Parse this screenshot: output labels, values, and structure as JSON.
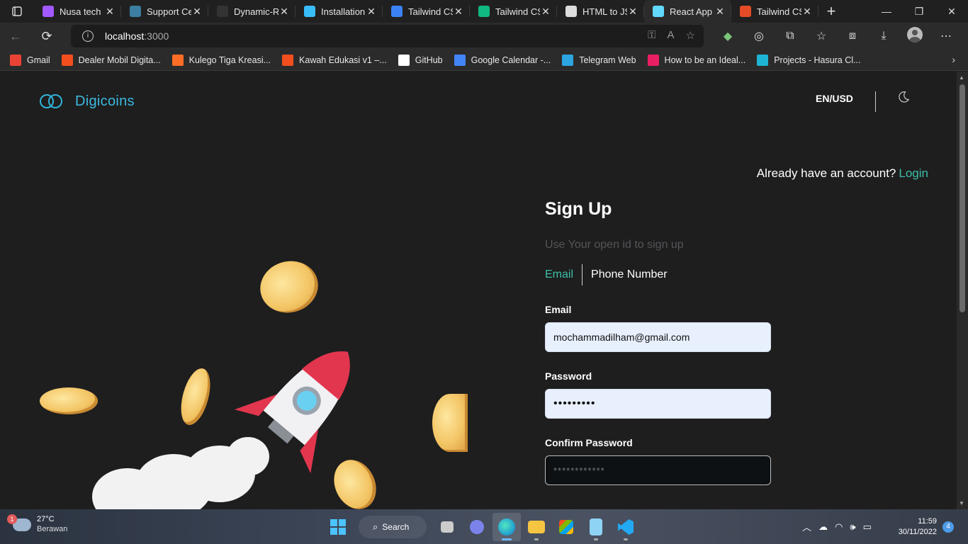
{
  "browser": {
    "tabs": [
      {
        "title": "Nusa tech",
        "icon": "figma-icon",
        "color": "#a259ff"
      },
      {
        "title": "Support Center",
        "icon": "support-icon",
        "color": "#3b7ea1"
      },
      {
        "title": "Dynamic-React",
        "icon": "github-icon",
        "color": "#333333"
      },
      {
        "title": "Installation",
        "icon": "tailwind-icon",
        "color": "#38bdf8"
      },
      {
        "title": "Tailwind CSS",
        "icon": "tailwind-elements-icon",
        "color": "#3b82f6"
      },
      {
        "title": "Tailwind CSS",
        "icon": "leaf-icon",
        "color": "#10b981"
      },
      {
        "title": "HTML to JSX",
        "icon": "document-icon",
        "color": "#dddddd"
      },
      {
        "title": "React App",
        "icon": "react-icon",
        "color": "#61dafb"
      },
      {
        "title": "Tailwind CSS",
        "icon": "code-icon",
        "color": "#e34c26"
      }
    ],
    "active_tab_index": 7,
    "url_host": "localhost",
    "url_port": ":3000",
    "bookmarks": [
      {
        "label": "Gmail",
        "icon": "gmail-icon",
        "color": "#ea4335"
      },
      {
        "label": "Dealer Mobil Digita...",
        "icon": "figma-icon",
        "color": "#f24e1e"
      },
      {
        "label": "Kulego Tiga Kreasi...",
        "icon": "gitlab-icon",
        "color": "#fc6d26"
      },
      {
        "label": "Kawah Edukasi v1 –...",
        "icon": "figma-icon",
        "color": "#f24e1e"
      },
      {
        "label": "GitHub",
        "icon": "github-icon",
        "color": "#ffffff"
      },
      {
        "label": "Google Calendar -...",
        "icon": "calendar-icon",
        "color": "#4285f4"
      },
      {
        "label": "Telegram Web",
        "icon": "telegram-icon",
        "color": "#2ca5e0"
      },
      {
        "label": "How to be an Ideal...",
        "icon": "dot-icon",
        "color": "#e91e63"
      },
      {
        "label": "Projects - Hasura Cl...",
        "icon": "hasura-icon",
        "color": "#1eb4d4"
      }
    ]
  },
  "app": {
    "brand": "Digicoins",
    "currency": "EN/USD",
    "have_account": "Already have an account?",
    "login_link": "Login",
    "form": {
      "title": "Sign Up",
      "subtitle": "Use Your open id to sign up",
      "tab_email": "Email",
      "tab_phone": "Phone Number",
      "email_label": "Email",
      "email_value": "mochammadilham@gmail.com",
      "password_label": "Password",
      "password_value": "•••••••••",
      "confirm_label": "Confirm Password",
      "confirm_value": "************"
    },
    "accent_color": "#3ebfa8",
    "brand_color": "#3bb9e0"
  },
  "taskbar": {
    "weather_temp": "27°C",
    "weather_desc": "Berawan",
    "weather_badge": "1",
    "search_label": "Search",
    "time": "11:59",
    "date": "30/11/2022",
    "notifications": "4"
  }
}
